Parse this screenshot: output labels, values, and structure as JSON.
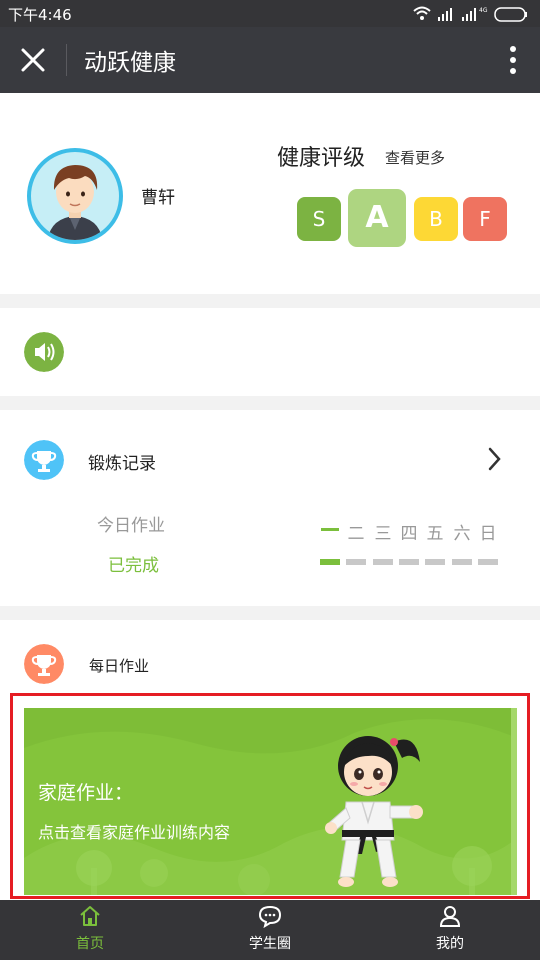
{
  "status_bar": {
    "time": "下午4:46",
    "network": "4G"
  },
  "header": {
    "title": "动跃健康",
    "close_icon": "close-icon",
    "more_icon": "more-vertical-icon"
  },
  "profile": {
    "username": "曹轩",
    "rating_title": "健康评级",
    "rating_more": "查看更多",
    "grades": [
      {
        "label": "S",
        "color": "#7cb342",
        "selected": false
      },
      {
        "label": "A",
        "color": "#aed581",
        "selected": true
      },
      {
        "label": "B",
        "color": "#fdd835",
        "selected": false
      },
      {
        "label": "F",
        "color": "#ef7360",
        "selected": false
      }
    ]
  },
  "notice": {
    "icon": "speaker-icon",
    "color": "#7cb342"
  },
  "record": {
    "title": "锻炼记录",
    "icon": "trophy-icon",
    "icon_color": "#4fc3f7",
    "today_label": "今日作业",
    "today_status": "已完成",
    "days": [
      "一",
      "二",
      "三",
      "四",
      "五",
      "六",
      "日"
    ],
    "current_day": 0,
    "accent": "#7bbf3c"
  },
  "daily": {
    "title": "每日作业",
    "icon_color": "#ff8a65",
    "banner_title": "家庭作业：",
    "banner_subtitle": "点击查看家庭作业训练内容",
    "highlight_color": "#e51c23"
  },
  "tabs": [
    {
      "label": "首页",
      "icon": "home-icon",
      "active": true
    },
    {
      "label": "学生圈",
      "icon": "chat-icon",
      "active": false
    },
    {
      "label": "我的",
      "icon": "person-icon",
      "active": false
    }
  ]
}
